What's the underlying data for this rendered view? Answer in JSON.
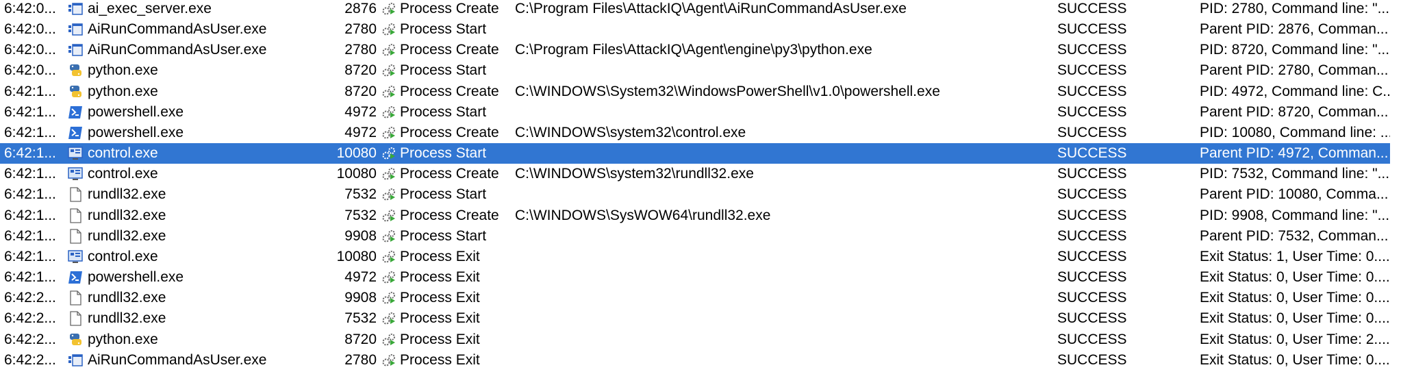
{
  "colors": {
    "selection": "#3176d2",
    "process_icon_blue": "#2a62c4",
    "powershell_blue": "#2c6fd6",
    "python_yellow": "#f2c230",
    "python_blue": "#3a6fb0"
  },
  "rows": [
    {
      "time": "6:42:0...",
      "icon": "app-window-icon",
      "process": "ai_exec_server.exe",
      "pid": "2876",
      "operation": "Process Create",
      "path": "C:\\Program Files\\AttackIQ\\Agent\\AiRunCommandAsUser.exe",
      "result": "SUCCESS",
      "detail": "PID: 2780, Command line: \"..."
    },
    {
      "time": "6:42:0...",
      "icon": "app-window-icon",
      "process": "AiRunCommandAsUser.exe",
      "pid": "2780",
      "operation": "Process Start",
      "path": "",
      "result": "SUCCESS",
      "detail": "Parent PID: 2876, Comman..."
    },
    {
      "time": "6:42:0...",
      "icon": "app-window-icon",
      "process": "AiRunCommandAsUser.exe",
      "pid": "2780",
      "operation": "Process Create",
      "path": "C:\\Program Files\\AttackIQ\\Agent\\engine\\py3\\python.exe",
      "result": "SUCCESS",
      "detail": "PID: 8720, Command line: \"..."
    },
    {
      "time": "6:42:0...",
      "icon": "python-icon",
      "process": "python.exe",
      "pid": "8720",
      "operation": "Process Start",
      "path": "",
      "result": "SUCCESS",
      "detail": "Parent PID: 2780, Comman..."
    },
    {
      "time": "6:42:1...",
      "icon": "python-icon",
      "process": "python.exe",
      "pid": "8720",
      "operation": "Process Create",
      "path": "C:\\WINDOWS\\System32\\WindowsPowerShell\\v1.0\\powershell.exe",
      "result": "SUCCESS",
      "detail": "PID: 4972, Command line: C..."
    },
    {
      "time": "6:42:1...",
      "icon": "powershell-icon",
      "process": "powershell.exe",
      "pid": "4972",
      "operation": "Process Start",
      "path": "",
      "result": "SUCCESS",
      "detail": "Parent PID: 8720, Comman..."
    },
    {
      "time": "6:42:1...",
      "icon": "powershell-icon",
      "process": "powershell.exe",
      "pid": "4972",
      "operation": "Process Create",
      "path": "C:\\WINDOWS\\system32\\control.exe",
      "result": "SUCCESS",
      "detail": "PID: 10080, Command line: ..."
    },
    {
      "time": "6:42:1...",
      "icon": "control-panel-icon",
      "process": "control.exe",
      "pid": "10080",
      "operation": "Process Start",
      "path": "",
      "result": "SUCCESS",
      "detail": "Parent PID: 4972, Comman...",
      "selected": true
    },
    {
      "time": "6:42:1...",
      "icon": "control-panel-icon",
      "process": "control.exe",
      "pid": "10080",
      "operation": "Process Create",
      "path": "C:\\WINDOWS\\system32\\rundll32.exe",
      "result": "SUCCESS",
      "detail": "PID: 7532, Command line: \"..."
    },
    {
      "time": "6:42:1...",
      "icon": "blank-file-icon",
      "process": "rundll32.exe",
      "pid": "7532",
      "operation": "Process Start",
      "path": "",
      "result": "SUCCESS",
      "detail": "Parent PID: 10080, Comma..."
    },
    {
      "time": "6:42:1...",
      "icon": "blank-file-icon",
      "process": "rundll32.exe",
      "pid": "7532",
      "operation": "Process Create",
      "path": "C:\\WINDOWS\\SysWOW64\\rundll32.exe",
      "result": "SUCCESS",
      "detail": "PID: 9908, Command line: \"..."
    },
    {
      "time": "6:42:1...",
      "icon": "blank-file-icon",
      "process": "rundll32.exe",
      "pid": "9908",
      "operation": "Process Start",
      "path": "",
      "result": "SUCCESS",
      "detail": "Parent PID: 7532, Comman..."
    },
    {
      "time": "6:42:1...",
      "icon": "control-panel-icon",
      "process": "control.exe",
      "pid": "10080",
      "operation": "Process Exit",
      "path": "",
      "result": "SUCCESS",
      "detail": "Exit Status: 1, User Time: 0...."
    },
    {
      "time": "6:42:1...",
      "icon": "powershell-icon",
      "process": "powershell.exe",
      "pid": "4972",
      "operation": "Process Exit",
      "path": "",
      "result": "SUCCESS",
      "detail": "Exit Status: 0, User Time: 0...."
    },
    {
      "time": "6:42:2...",
      "icon": "blank-file-icon",
      "process": "rundll32.exe",
      "pid": "9908",
      "operation": "Process Exit",
      "path": "",
      "result": "SUCCESS",
      "detail": "Exit Status: 0, User Time: 0...."
    },
    {
      "time": "6:42:2...",
      "icon": "blank-file-icon",
      "process": "rundll32.exe",
      "pid": "7532",
      "operation": "Process Exit",
      "path": "",
      "result": "SUCCESS",
      "detail": "Exit Status: 0, User Time: 0...."
    },
    {
      "time": "6:42:2...",
      "icon": "python-icon",
      "process": "python.exe",
      "pid": "8720",
      "operation": "Process Exit",
      "path": "",
      "result": "SUCCESS",
      "detail": "Exit Status: 0, User Time: 2...."
    },
    {
      "time": "6:42:2...",
      "icon": "app-window-icon",
      "process": "AiRunCommandAsUser.exe",
      "pid": "2780",
      "operation": "Process Exit",
      "path": "",
      "result": "SUCCESS",
      "detail": "Exit Status: 0, User Time: 0...."
    }
  ]
}
